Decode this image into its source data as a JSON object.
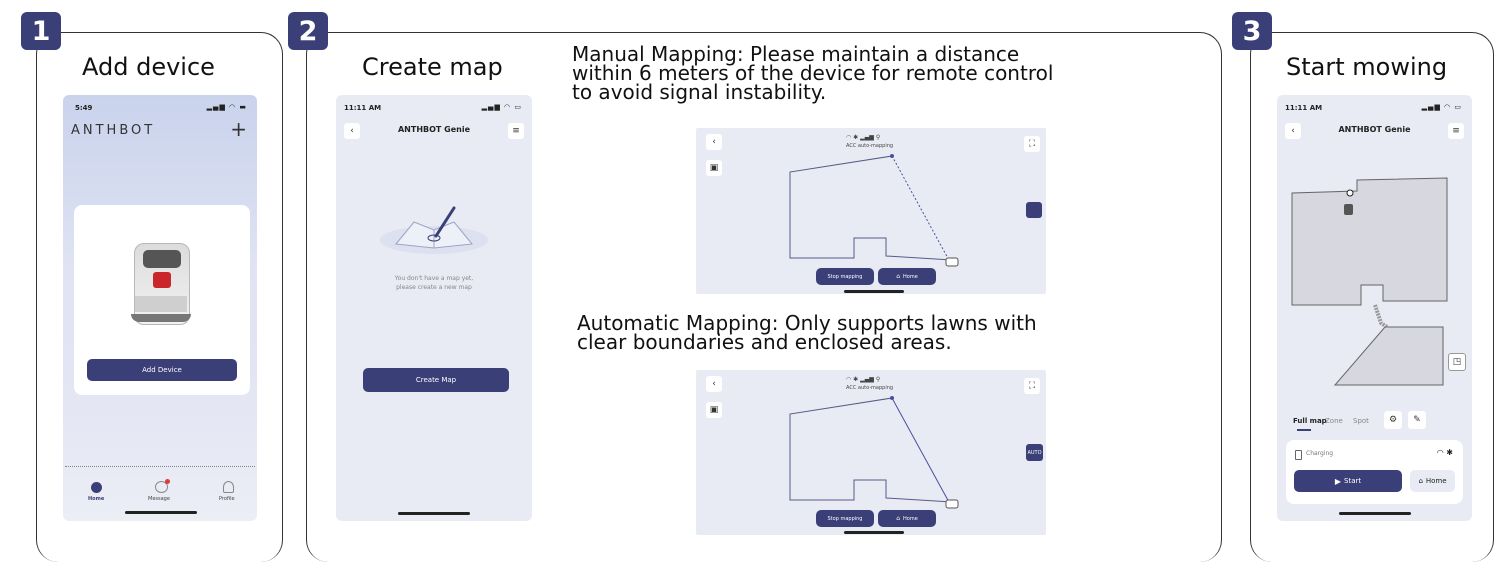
{
  "steps": [
    {
      "number": "1",
      "title": "Add device"
    },
    {
      "number": "2",
      "title": "Create map"
    },
    {
      "number": "3",
      "title": "Start mowing"
    }
  ],
  "phone1": {
    "time": "5:49",
    "brand": "ANTHBOT",
    "plus": "+",
    "add_device_label": "Add Device",
    "nav": [
      "Home",
      "Message",
      "Profile"
    ]
  },
  "phone2": {
    "time": "11:11 AM",
    "title": "ANTHBOT Genie",
    "empty_line1": "You don't have a map yet,",
    "empty_line2": "please create a new map",
    "create_map_label": "Create Map"
  },
  "manual": {
    "line1": "Manual Mapping: Please maintain a distance",
    "line2": "within 6 meters of the device for remote control",
    "line3": "to avoid signal instability.",
    "shot_status": "ACC auto-mapping",
    "stop_label": "Stop mapping",
    "home_label": "Home"
  },
  "automatic": {
    "line1": "Automatic Mapping: Only supports lawns with",
    "line2": "clear boundaries and enclosed areas.",
    "shot_status": "ACC auto-mapping",
    "auto_label": "AUTO",
    "stop_label": "Stop mapping",
    "home_label": "Home"
  },
  "phone3": {
    "time": "11:11 AM",
    "title": "ANTHBOT Genie",
    "tabs": [
      "Full map",
      "Zone",
      "Spot"
    ],
    "charging": "Charging",
    "start_label": "Start",
    "home_label": "Home"
  },
  "colors": {
    "accent": "#3a3f78",
    "phone_bg": "#e8eaf4",
    "map_fill": "#d6d7df"
  }
}
